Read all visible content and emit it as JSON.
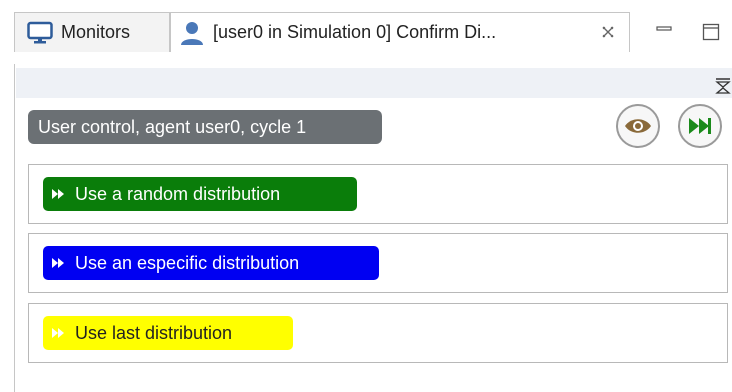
{
  "tabs": [
    {
      "label": "Monitors",
      "icon": "monitor-icon"
    },
    {
      "label": "[user0 in Simulation 0] Confirm Di...",
      "icon": "user-icon",
      "active": true
    }
  ],
  "panel": {
    "status": "User control, agent user0, cycle 1",
    "options": [
      {
        "label": "Use a random distribution",
        "color": "#0a7d0a"
      },
      {
        "label": "Use an especific distribution",
        "color": "#0000f2"
      },
      {
        "label": "Use last distribution",
        "color": "#ffff00"
      }
    ]
  },
  "colors": {
    "status_badge": "#6b7074",
    "fast_forward_green": "#1a8a1a",
    "eye_brown": "#8a6a3a"
  }
}
